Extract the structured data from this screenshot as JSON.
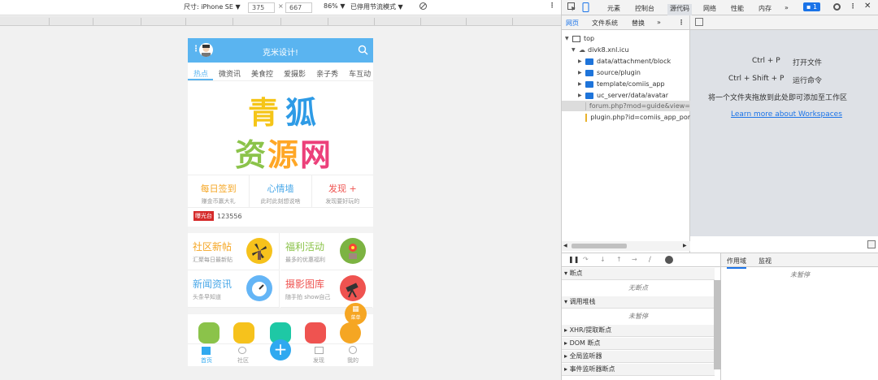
{
  "device_toolbar": {
    "dimensions_label": "尺寸: iPhone SE ▼",
    "width": "375",
    "times": "×",
    "height": "667",
    "zoom": "86% ▼",
    "throttle": "已停用节流模式 ▼"
  },
  "phone": {
    "header_title": "克米设计!",
    "tabs": [
      "热点",
      "微资讯",
      "美食控",
      "爱摄影",
      "亲子秀",
      "车互动"
    ],
    "banner": {
      "line1_a": "青",
      "line1_b": "狐",
      "line2_a": "资",
      "line2_b": "源",
      "line2_c": "网"
    },
    "quick_links": [
      {
        "title": "每日签到",
        "sub": "赚金币赢大礼"
      },
      {
        "title": "心情墙",
        "sub": "此时此刻想说啥"
      },
      {
        "title": "发现 +",
        "sub": "发现要好玩的"
      }
    ],
    "news_tag": "曝光台",
    "news_text": "123556",
    "cards": [
      {
        "title": "社区新帖",
        "sub": "汇聚每日最新贴"
      },
      {
        "title": "福利活动",
        "sub": "最多的优惠福利"
      },
      {
        "title": "新闻资讯",
        "sub": "头条早知道"
      },
      {
        "title": "摄影图库",
        "sub": "随手拍 show自己"
      }
    ],
    "float_button": "菜单",
    "tabbar": [
      "首页",
      "社区",
      "发现",
      "我的"
    ]
  },
  "devtools": {
    "tabs": [
      "元素",
      "控制台",
      "源代码",
      "网络",
      "性能",
      "内存"
    ],
    "more": "»",
    "badge": "1",
    "navigator_tabs": [
      "网页",
      "文件系统",
      "替换",
      "»"
    ],
    "tree": [
      {
        "label": "top"
      },
      {
        "label": "divk8.xnl.icu"
      },
      {
        "label": "data/attachment/block"
      },
      {
        "label": "source/plugin"
      },
      {
        "label": "template/comiis_app"
      },
      {
        "label": "uc_server/data/avatar"
      },
      {
        "label": "forum.php?mod=guide&view="
      },
      {
        "label": "plugin.php?id=comiis_app_por"
      }
    ],
    "shortcuts": [
      {
        "keys": "Ctrl + P",
        "action": "打开文件"
      },
      {
        "keys": "Ctrl + Shift + P",
        "action": "运行命令"
      }
    ],
    "drop_hint": "将一个文件夹拖放到此处即可添加至工作区",
    "workspace_link": "Learn more about Workspaces",
    "sections": [
      {
        "title": "断点",
        "message": "无断点"
      },
      {
        "title": "调用堆栈",
        "message": "未暂停"
      },
      {
        "title": "XHR/提取断点"
      },
      {
        "title": "DOM 断点"
      },
      {
        "title": "全局监听器"
      },
      {
        "title": "事件监听器断点"
      }
    ],
    "scope_tabs": [
      "作用域",
      "监视"
    ],
    "scope_message": "未暂停"
  },
  "colors": {
    "accent": "#5ab4f0",
    "link": "#1a73e8",
    "tag": "#d52a2a"
  }
}
